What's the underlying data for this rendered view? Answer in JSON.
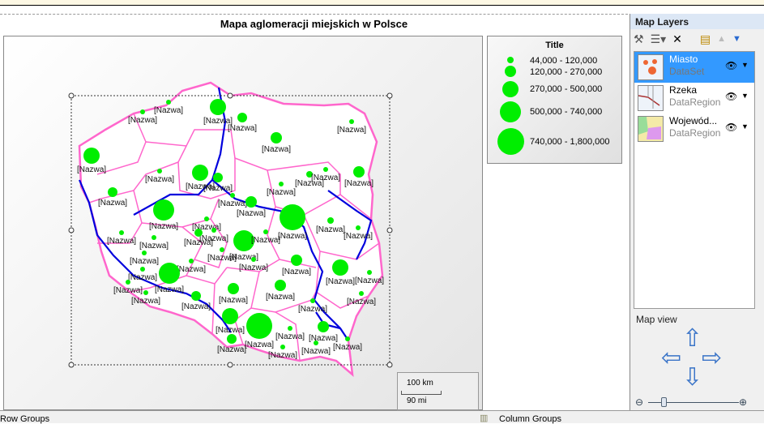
{
  "report": {
    "title": "Mapa aglomeracji miejskich w Polsce"
  },
  "map": {
    "city_label": "[Nazwa]",
    "colors": {
      "city": "#00ee00",
      "border": "#ff66cc",
      "river": "#0000dd",
      "land": "#ffffff"
    }
  },
  "legend": {
    "title": "Title",
    "items": [
      {
        "label": "44,000 - 120,000"
      },
      {
        "label": "120,000 - 270,000"
      },
      {
        "label": "270,000 - 500,000"
      },
      {
        "label": "500,000 - 740,000"
      },
      {
        "label": "740,000 - 1,800,000"
      }
    ]
  },
  "scale": {
    "km": "100 km",
    "mi": "90 mi"
  },
  "panel": {
    "title": "Map Layers",
    "layers": [
      {
        "name": "Miasto",
        "type": "DataSet",
        "selected": true
      },
      {
        "name": "Rzeka",
        "type": "DataRegion"
      },
      {
        "name": "Wojewód...",
        "type": "DataRegion"
      }
    ],
    "map_view_label": "Map view"
  },
  "bottom": {
    "row_groups": "Row Groups",
    "column_groups": "Column Groups"
  }
}
